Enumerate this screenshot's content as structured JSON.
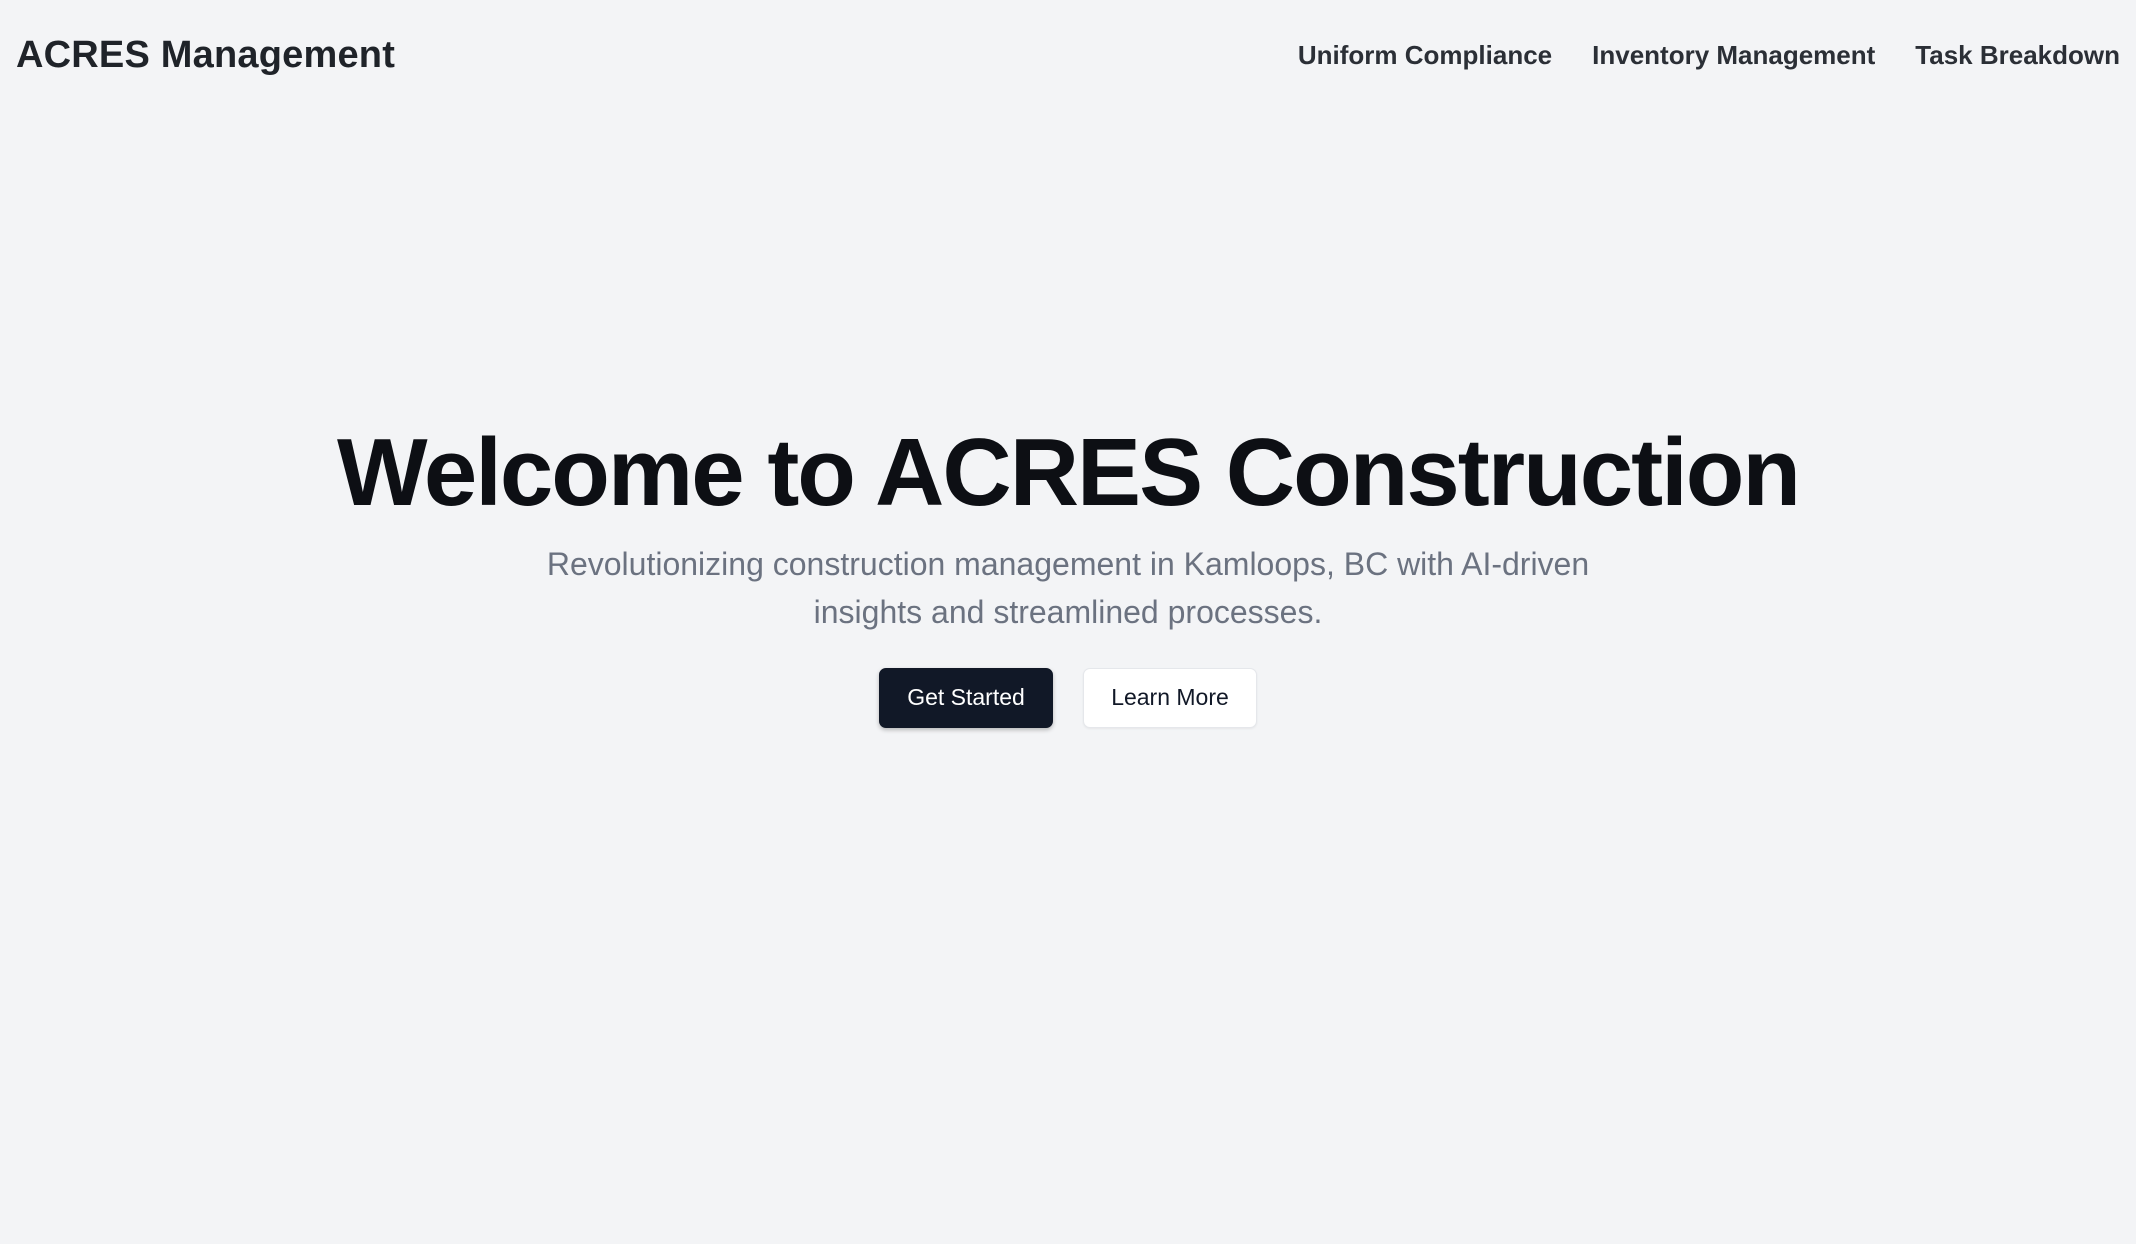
{
  "header": {
    "brand": "ACRES Management",
    "nav": [
      {
        "label": "Uniform Compliance"
      },
      {
        "label": "Inventory Management"
      },
      {
        "label": "Task Breakdown"
      }
    ]
  },
  "hero": {
    "title": "Welcome to ACRES Construction",
    "subtitle": "Revolutionizing construction management in Kamloops, BC with AI-driven insights and streamlined processes.",
    "primary_button": "Get Started",
    "secondary_button": "Learn More"
  },
  "colors": {
    "background": "#f3f4f6",
    "primary_button": "#111827",
    "subtitle_text": "#6b7280"
  }
}
